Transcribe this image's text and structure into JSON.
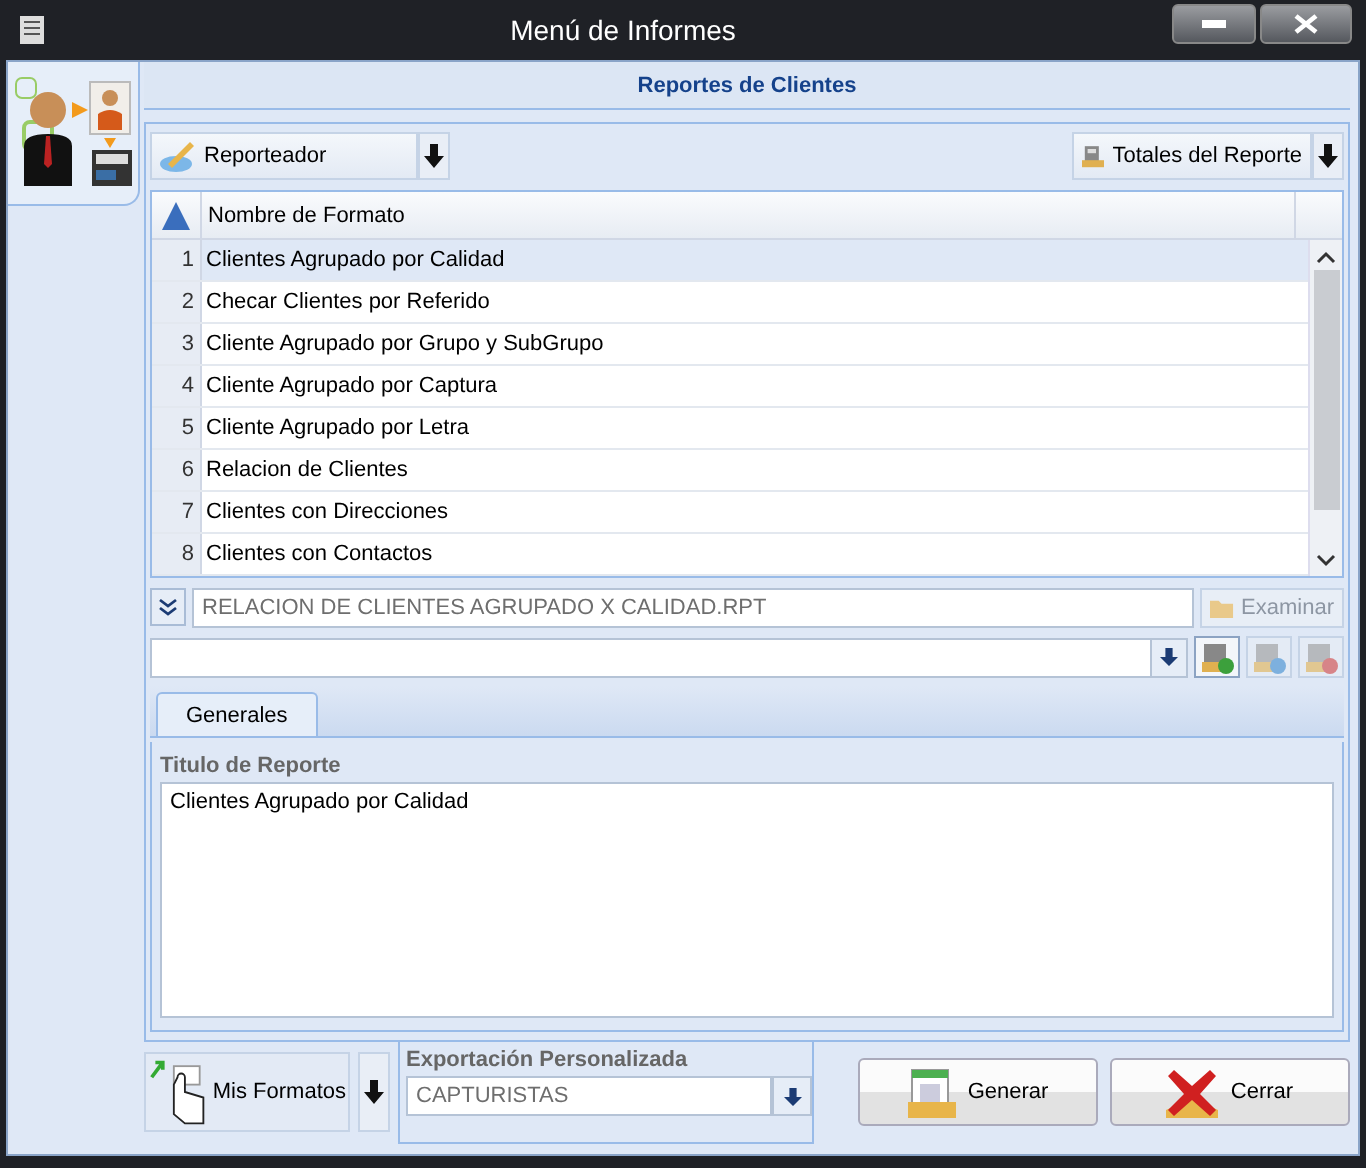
{
  "window": {
    "title": "Menú de Informes"
  },
  "header": "Reportes de Clientes",
  "toolbar": {
    "left_button": "Reporteador",
    "right_button": "Totales del Reporte"
  },
  "table": {
    "columns": [
      "Nombre de Formato"
    ],
    "rows": [
      {
        "number": "1",
        "name": "Clientes Agrupado por Calidad",
        "selected": true
      },
      {
        "number": "2",
        "name": "Checar Clientes por Referido",
        "selected": false
      },
      {
        "number": "3",
        "name": "Cliente Agrupado por Grupo y SubGrupo",
        "selected": false
      },
      {
        "number": "4",
        "name": "Cliente Agrupado por Captura",
        "selected": false
      },
      {
        "number": "5",
        "name": "Cliente Agrupado por Letra",
        "selected": false
      },
      {
        "number": "6",
        "name": "Relacion de Clientes",
        "selected": false
      },
      {
        "number": "7",
        "name": "Clientes con Direcciones",
        "selected": false
      },
      {
        "number": "8",
        "name": "Clientes con Contactos",
        "selected": false
      }
    ]
  },
  "file_field": {
    "value": "RELACION DE CLIENTES AGRUPADO X CALIDAD.RPT",
    "browse_button": "Examinar",
    "browse_disabled": true
  },
  "tabs": [
    {
      "label": "Generales",
      "selected": true
    }
  ],
  "report_title": {
    "label": "Titulo de Reporte",
    "value": "Clientes Agrupado por Calidad"
  },
  "footer": {
    "formats_button": "Mis Formatos",
    "export": {
      "label": "Exportación Personalizada",
      "value": "CAPTURISTAS"
    },
    "buttons": [
      {
        "label": "Generar",
        "kind": "generate"
      },
      {
        "label": "Cerrar",
        "kind": "close"
      }
    ]
  }
}
